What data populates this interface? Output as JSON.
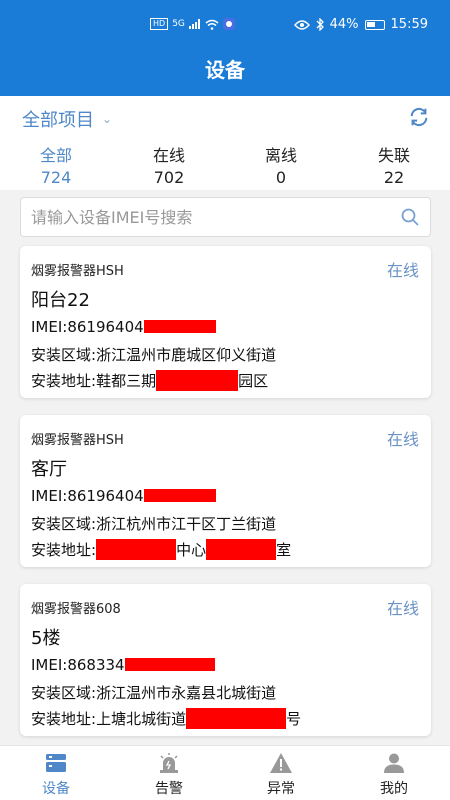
{
  "statusbar": {
    "left_badges": "HD",
    "signal": "5G",
    "battery": "44%",
    "time": "15:59"
  },
  "header": {
    "title": "设备"
  },
  "filter": {
    "project_label": "全部项目",
    "stats": [
      {
        "label": "全部",
        "value": "724"
      },
      {
        "label": "在线",
        "value": "702"
      },
      {
        "label": "离线",
        "value": "0"
      },
      {
        "label": "失联",
        "value": "22"
      }
    ]
  },
  "search": {
    "placeholder": "请输入设备IMEI号搜索"
  },
  "devices": [
    {
      "type": "烟雾报警器HSH",
      "status": "在线",
      "name": "阳台22",
      "imei_prefix": "IMEI:86196404",
      "area_label": "安装区域:",
      "area": "浙江温州市鹿城区仰义街道",
      "addr_label": "安装地址:",
      "addr_part1": "鞋都三期",
      "addr_part2": "园区"
    },
    {
      "type": "烟雾报警器HSH",
      "status": "在线",
      "name": "客厅",
      "imei_prefix": "IMEI:86196404",
      "area_label": "安装区域:",
      "area": "浙江杭州市江干区丁兰街道",
      "addr_label": "安装地址:",
      "addr_part1": "中心",
      "addr_part2": "室"
    },
    {
      "type": "烟雾报警器608",
      "status": "在线",
      "name": "5楼",
      "imei_prefix": "IMEI:868334",
      "area_label": "安装区域:",
      "area": "浙江温州市永嘉县北城街道",
      "addr_label": "安装地址:",
      "addr_part1": "上塘北城街道",
      "addr_part2": "号"
    }
  ],
  "tabbar": {
    "items": [
      {
        "label": "设备",
        "icon": "device-icon"
      },
      {
        "label": "告警",
        "icon": "alarm-icon"
      },
      {
        "label": "异常",
        "icon": "warning-icon"
      },
      {
        "label": "我的",
        "icon": "user-icon"
      }
    ]
  },
  "colors": {
    "primary": "#1a7cd6",
    "accent_text": "#4f88c8",
    "redaction": "#ff0000"
  }
}
